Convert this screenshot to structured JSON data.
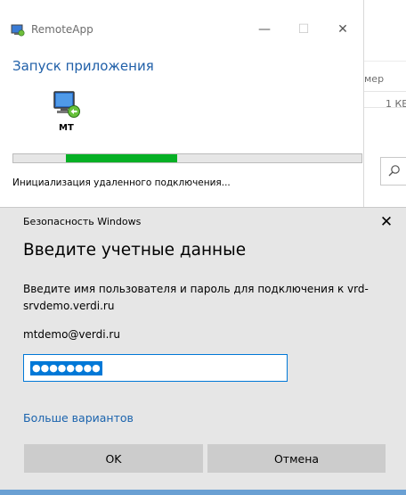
{
  "remoteapp": {
    "title": "RemoteApp",
    "heading": "Запуск приложения",
    "app_name": "MT",
    "progress": 0.32,
    "progress_start": 0.15,
    "status": "Инициализация удаленного подключения...",
    "controls": {
      "minimize": "—",
      "maximize": "☐",
      "close": "✕"
    }
  },
  "background_window": {
    "text1": "мер",
    "text2": "1 КБ"
  },
  "security_dialog": {
    "title": "Безопасность Windows",
    "close": "✕",
    "heading": "Введите учетные данные",
    "description": "Введите имя пользователя и пароль для подключения к vrd-srvdemo.verdi.ru",
    "username": "mtdemo@verdi.ru",
    "password_masked": "●●●●●●●●",
    "more_options": "Больше вариантов",
    "ok_label": "OK",
    "cancel_label": "Отмена"
  },
  "colors": {
    "accent": "#0078d7",
    "progress": "#06b025",
    "heading_blue": "#1f5fa8"
  },
  "icons": {
    "app": "remoteapp-icon",
    "monitor": "remote-desktop-monitor-icon",
    "search": "search-icon"
  }
}
